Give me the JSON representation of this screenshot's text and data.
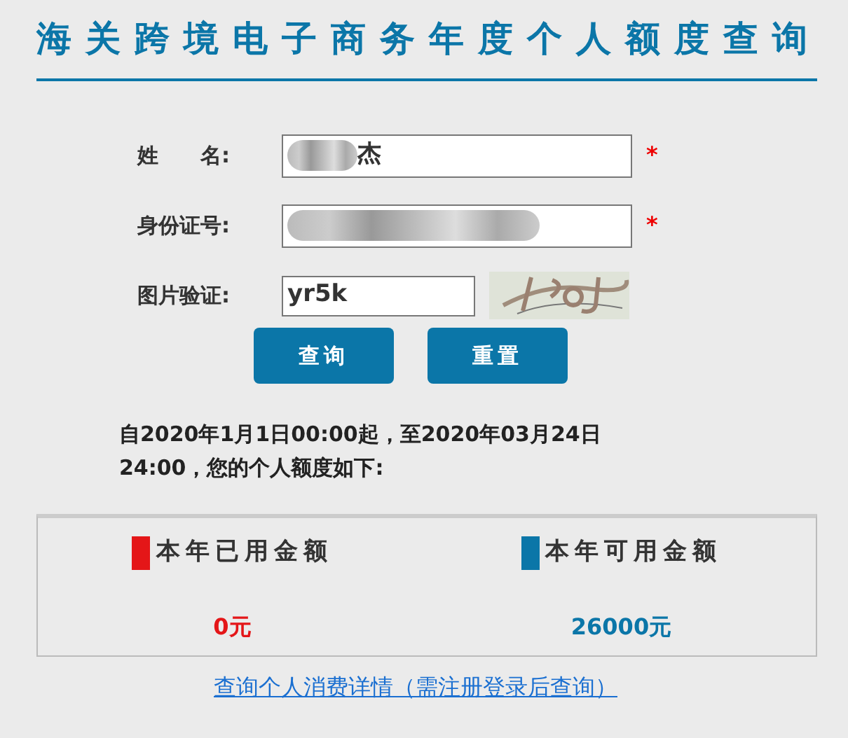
{
  "title": "海关跨境电子商务年度个人额度查询",
  "fields": [
    {
      "kind": "text",
      "label": "姓　　名:",
      "value": "杰",
      "masked": true,
      "required_mark": "*"
    },
    {
      "kind": "text",
      "label": "身份证号:",
      "masked": true,
      "required_mark": "*"
    },
    {
      "kind": "captcha",
      "label": "图片验证:",
      "value": "yr5k"
    }
  ],
  "buttons": [
    "查询",
    "重置"
  ],
  "notice": "自2020年1月1日00:00起，至2020年03月24日24:00，您的个人额度如下:",
  "quotas": [
    {
      "label": "本年已用金额",
      "amount": "0元",
      "color": "#e41618"
    },
    {
      "label": "本年可用金额",
      "amount": "26000元",
      "color": "#0b76a8"
    }
  ],
  "link": "查询个人消费详情（需注册登录后查询）"
}
